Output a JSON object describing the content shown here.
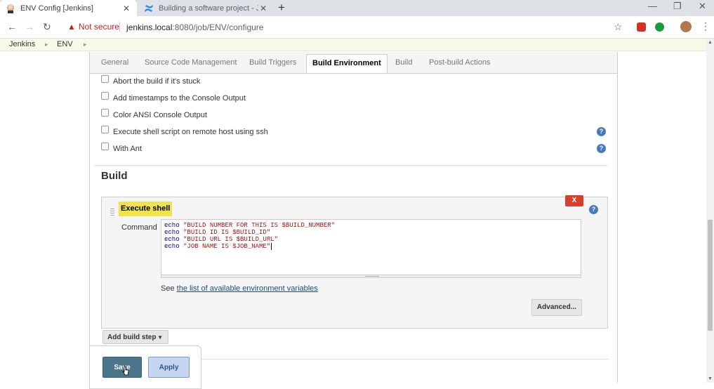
{
  "browser": {
    "tabs": [
      {
        "title": "ENV Config [Jenkins]",
        "active": true
      },
      {
        "title": "Building a software project - Jen",
        "active": false
      }
    ],
    "new_tab": "+",
    "window_controls": {
      "minimize": "—",
      "restore": "❐",
      "close": "✕"
    },
    "security_label": "Not secure",
    "url_host": "jenkins.local",
    "url_path": ":8080/job/ENV/configure"
  },
  "breadcrumb": {
    "items": [
      "Jenkins",
      "ENV"
    ]
  },
  "config_tabs": [
    "General",
    "Source Code Management",
    "Build Triggers",
    "Build Environment",
    "Build",
    "Post-build Actions"
  ],
  "selected_tab": "Build Environment",
  "build_env_options": [
    {
      "label": "Abort the build if it's stuck",
      "checked": false,
      "help": false
    },
    {
      "label": "Add timestamps to the Console Output",
      "checked": false,
      "help": false
    },
    {
      "label": "Color ANSI Console Output",
      "checked": false,
      "help": false
    },
    {
      "label": "Execute shell script on remote host using ssh",
      "checked": false,
      "help": true
    },
    {
      "label": "With Ant",
      "checked": false,
      "help": true
    }
  ],
  "build": {
    "heading": "Build",
    "step": {
      "title": "Execute shell",
      "delete_label": "X",
      "command_label": "Command",
      "command_lines": [
        {
          "kw": "echo",
          "str": "\"BUILD NUMBER FOR THIS IS $BUILD_NUMBER\""
        },
        {
          "kw": "echo",
          "str": "\"BUILD ID IS $BUILD_ID\""
        },
        {
          "kw": "echo",
          "str": "\"BUILD URL IS $BUILD_URL\""
        },
        {
          "kw": "echo",
          "str": "\"JOB NAME IS $JOB_NAME\""
        }
      ],
      "see_prefix": "See",
      "env_link": "the list of available environment variables",
      "advanced_label": "Advanced..."
    },
    "add_step_label": "Add build step"
  },
  "actions": {
    "save": "Save",
    "apply": "Apply"
  },
  "help_glyph": "?"
}
